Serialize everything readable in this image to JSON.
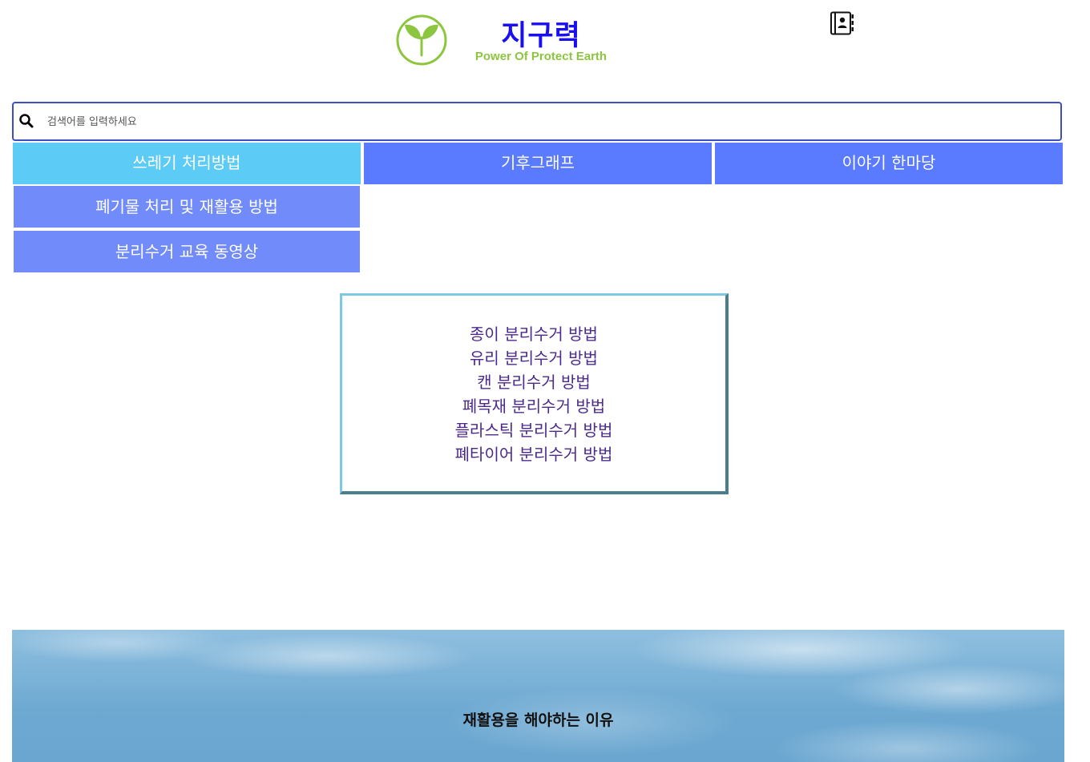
{
  "header": {
    "title": "지구력",
    "subtitle": "Power Of Protect Earth",
    "logo_icon": "sprout-leaf-icon",
    "contacts_icon": "address-book-icon",
    "brand_color": "#1a0ff0",
    "accent_color": "#8cc63f"
  },
  "search": {
    "placeholder": "검색어를 입력하세요",
    "value": "",
    "icon": "search-icon"
  },
  "nav": {
    "tabs": [
      {
        "label": "쓰레기 처리방법",
        "color": "#5ccbf5"
      },
      {
        "label": "기후그래프",
        "color": "#5a7bff"
      },
      {
        "label": "이야기 한마당",
        "color": "#5a7bff"
      }
    ],
    "submenu": [
      {
        "label": "폐기물 처리 및 재활용 방법"
      },
      {
        "label": "분리수거 교육 동영상"
      }
    ],
    "submenu_color": "#718bfb"
  },
  "methods": {
    "items": [
      "종이 분리수거 방법",
      "유리 분리수거 방법",
      "캔 분리수거 방법",
      "폐목재 분리수거 방법",
      "플라스틱 분리수거 방법",
      "폐타이어 분리수거 방법"
    ],
    "text_color": "#4b2a8c"
  },
  "banner": {
    "title": "재활용을 해야하는 이유"
  }
}
